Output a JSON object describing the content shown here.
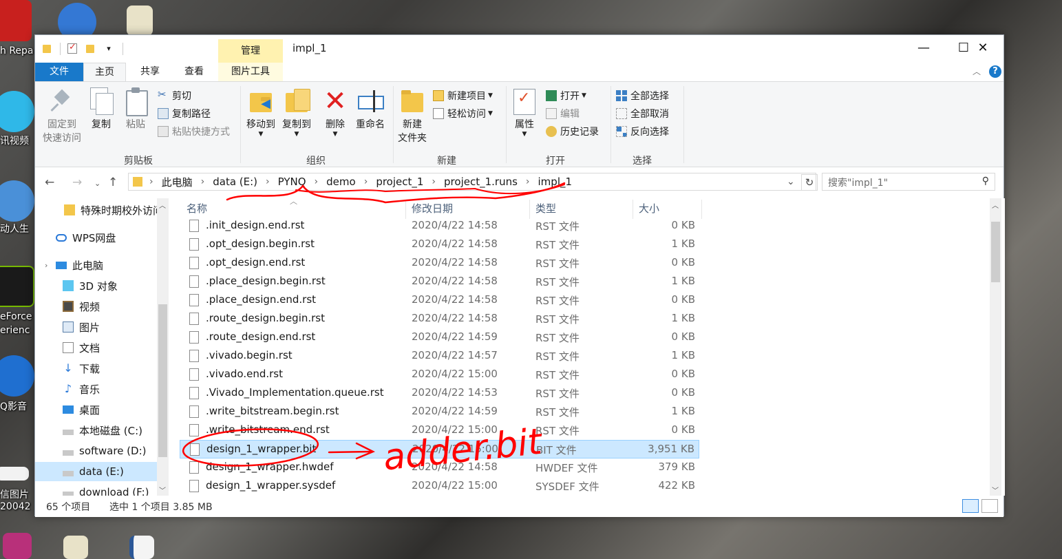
{
  "desktop": {
    "labels": [
      "h Repa",
      "讯视频",
      "动人生",
      "eForce",
      "erienc",
      "Q影音",
      "信图片",
      "20042"
    ]
  },
  "window": {
    "title": "impl_1",
    "manage_tab": "管理",
    "controls": {
      "minimize": "—",
      "maximize": "☐",
      "close": "✕"
    }
  },
  "ribbon_tabs": {
    "file": "文件",
    "home": "主页",
    "share": "共享",
    "view": "查看",
    "picture_tools": "图片工具"
  },
  "ribbon": {
    "clipboard": {
      "label": "剪贴板",
      "pin": "固定到\n快速访问",
      "copy": "复制",
      "paste": "粘贴",
      "cut": "剪切",
      "copy_path": "复制路径",
      "paste_shortcut": "粘贴快捷方式"
    },
    "organize": {
      "label": "组织",
      "move_to": "移动到",
      "copy_to": "复制到",
      "delete": "删除",
      "rename": "重命名"
    },
    "new": {
      "label": "新建",
      "new_folder": "新建\n文件夹",
      "new_item": "新建项目",
      "easy_access": "轻松访问"
    },
    "open": {
      "label": "打开",
      "properties": "属性",
      "open": "打开",
      "edit": "编辑",
      "history": "历史记录"
    },
    "select": {
      "label": "选择",
      "select_all": "全部选择",
      "select_none": "全部取消",
      "invert": "反向选择"
    }
  },
  "nav": {
    "breadcrumbs": [
      "此电脑",
      "data (E:)",
      "PYNQ",
      "demo",
      "project_1",
      "project_1.runs",
      "impl_1"
    ],
    "search_placeholder": "搜索\"impl_1\""
  },
  "sidebar": {
    "items": [
      {
        "label": "特殊时期校外访问",
        "icon": "folder-icon"
      },
      {
        "label": "WPS网盘",
        "icon": "cloud-icon"
      },
      {
        "label": "此电脑",
        "icon": "computer-icon"
      },
      {
        "label": "3D 对象",
        "icon": "cube-icon"
      },
      {
        "label": "视频",
        "icon": "video-icon"
      },
      {
        "label": "图片",
        "icon": "picture-icon"
      },
      {
        "label": "文档",
        "icon": "document-icon"
      },
      {
        "label": "下载",
        "icon": "download-icon"
      },
      {
        "label": "音乐",
        "icon": "music-icon"
      },
      {
        "label": "桌面",
        "icon": "desktop-icon"
      },
      {
        "label": "本地磁盘 (C:)",
        "icon": "drive-icon"
      },
      {
        "label": "software (D:)",
        "icon": "drive-icon"
      },
      {
        "label": "data (E:)",
        "icon": "drive-icon"
      },
      {
        "label": "download (F:)",
        "icon": "drive-icon"
      }
    ]
  },
  "columns": {
    "name": "名称",
    "date": "修改日期",
    "type": "类型",
    "size": "大小"
  },
  "files": [
    {
      "name": ".init_design.end.rst",
      "date": "2020/4/22 14:58",
      "type": "RST 文件",
      "size": "0 KB"
    },
    {
      "name": ".opt_design.begin.rst",
      "date": "2020/4/22 14:58",
      "type": "RST 文件",
      "size": "1 KB"
    },
    {
      "name": ".opt_design.end.rst",
      "date": "2020/4/22 14:58",
      "type": "RST 文件",
      "size": "0 KB"
    },
    {
      "name": ".place_design.begin.rst",
      "date": "2020/4/22 14:58",
      "type": "RST 文件",
      "size": "1 KB"
    },
    {
      "name": ".place_design.end.rst",
      "date": "2020/4/22 14:58",
      "type": "RST 文件",
      "size": "0 KB"
    },
    {
      "name": ".route_design.begin.rst",
      "date": "2020/4/22 14:58",
      "type": "RST 文件",
      "size": "1 KB"
    },
    {
      "name": ".route_design.end.rst",
      "date": "2020/4/22 14:59",
      "type": "RST 文件",
      "size": "0 KB"
    },
    {
      "name": ".vivado.begin.rst",
      "date": "2020/4/22 14:57",
      "type": "RST 文件",
      "size": "1 KB"
    },
    {
      "name": ".vivado.end.rst",
      "date": "2020/4/22 15:00",
      "type": "RST 文件",
      "size": "0 KB"
    },
    {
      "name": ".Vivado_Implementation.queue.rst",
      "date": "2020/4/22 14:53",
      "type": "RST 文件",
      "size": "0 KB"
    },
    {
      "name": ".write_bitstream.begin.rst",
      "date": "2020/4/22 14:59",
      "type": "RST 文件",
      "size": "1 KB"
    },
    {
      "name": ".write_bitstream.end.rst",
      "date": "2020/4/22 15:00",
      "type": "RST 文件",
      "size": "0 KB"
    },
    {
      "name": "design_1_wrapper.bit",
      "date": "2020/4/22 15:00",
      "type": "BIT 文件",
      "size": "3,951 KB",
      "selected": true
    },
    {
      "name": "design_1_wrapper.hwdef",
      "date": "2020/4/22 14:58",
      "type": "HWDEF 文件",
      "size": "379 KB"
    },
    {
      "name": "design_1_wrapper.sysdef",
      "date": "2020/4/22 15:00",
      "type": "SYSDEF 文件",
      "size": "422 KB"
    }
  ],
  "status": {
    "count": "65 个项目",
    "selection": "选中 1 个项目  3.85 MB"
  },
  "annotation": {
    "text": "adder.bit",
    "color": "#ff0000"
  }
}
